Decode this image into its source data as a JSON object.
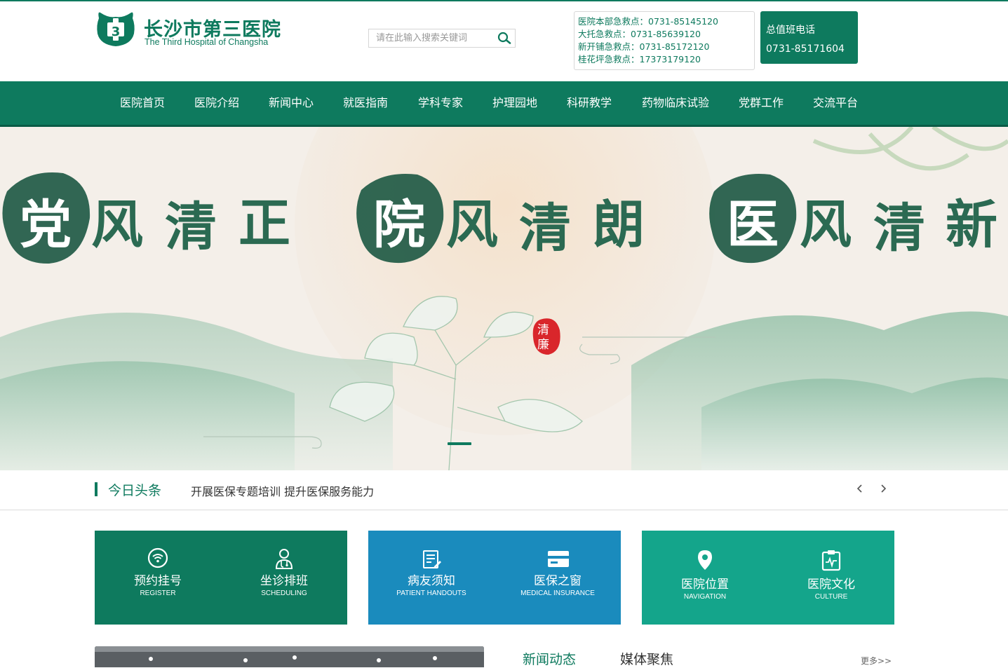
{
  "header": {
    "logo_cn": "长沙市第三医院",
    "logo_en": "The Third Hospital of Changsha",
    "search_placeholder": "请在此输入搜索关键词",
    "emergency": [
      "医院本部急救点：0731-85145120",
      "大托急救点：0731-85639120",
      "新开铺急救点：0731-85172120",
      "桂花坪急救点：17373179120"
    ],
    "duty_title": "总值班电话",
    "duty_phone": "0731-85171604"
  },
  "nav": [
    "医院首页",
    "医院介绍",
    "新闻中心",
    "就医指南",
    "学科专家",
    "护理园地",
    "科研教学",
    "药物临床试验",
    "党群工作",
    "交流平台"
  ],
  "banner": {
    "line1": [
      "党",
      "风",
      "清",
      "正"
    ],
    "line2": [
      "院",
      "风",
      "清",
      "朗"
    ],
    "line3": [
      "医",
      "风",
      "清",
      "新"
    ],
    "seal": [
      "清",
      "廉"
    ],
    "active_slide": 1
  },
  "headline": {
    "label": "今日头条",
    "text": "开展医保专题培训 提升医保服务能力"
  },
  "services": [
    {
      "cn": "预约挂号",
      "en": "REGISTER",
      "icon": "wifi-circle-icon"
    },
    {
      "cn": "坐诊排班",
      "en": "SCHEDULING",
      "icon": "doctor-icon"
    },
    {
      "cn": "病友须知",
      "en": "PATIENT HANDOUTS",
      "icon": "notepad-icon"
    },
    {
      "cn": "医保之窗",
      "en": "MEDICAL INSURANCE",
      "icon": "card-icon"
    },
    {
      "cn": "医院位置",
      "en": "NAVIGATION",
      "icon": "location-pin-icon"
    },
    {
      "cn": "医院文化",
      "en": "CULTURE",
      "icon": "clipboard-pulse-icon"
    }
  ],
  "colors": {
    "primary": "#0e7a5e",
    "blue": "#1a8bbd",
    "teal": "#14a58b"
  },
  "news": {
    "tab1": "新闻动态",
    "tab2": "媒体聚焦",
    "more": "更多>>"
  }
}
